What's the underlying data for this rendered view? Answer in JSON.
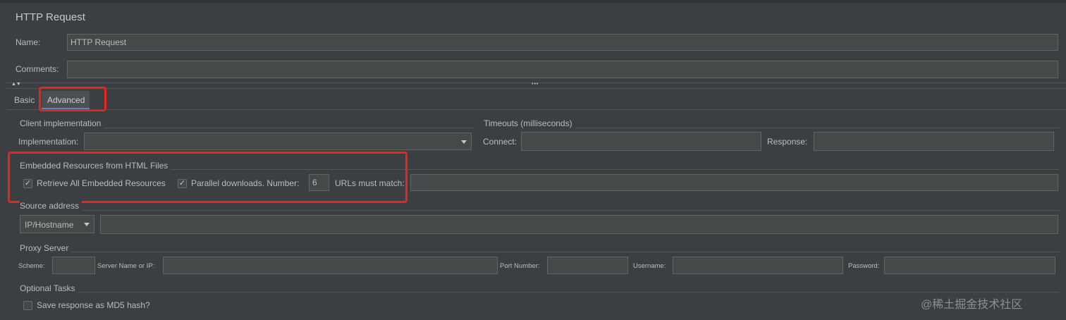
{
  "title": "HTTP Request",
  "name_label": "Name:",
  "name_value": "HTTP Request",
  "comments_label": "Comments:",
  "comments_value": "",
  "tabs": [
    {
      "label": "Basic"
    },
    {
      "label": "Advanced"
    }
  ],
  "client": {
    "title": "Client implementation",
    "impl_label": "Implementation:",
    "impl_value": ""
  },
  "timeouts": {
    "title": "Timeouts (milliseconds)",
    "connect_label": "Connect:",
    "response_label": "Response:"
  },
  "embedded": {
    "title": "Embedded Resources from HTML Files",
    "retrieve_label": "Retrieve All Embedded Resources",
    "parallel_label": "Parallel downloads. Number:",
    "parallel_number": "6",
    "urls_label": "URLs must match:"
  },
  "source": {
    "title": "Source address",
    "type_value": "IP/Hostname"
  },
  "proxy": {
    "title": "Proxy Server",
    "scheme_label": "Scheme:",
    "server_label": "Server Name or IP:",
    "port_label": "Port Number:",
    "username_label": "Username:",
    "password_label": "Password:"
  },
  "optional": {
    "title": "Optional Tasks",
    "md5_label": "Save response as MD5 hash?"
  },
  "watermark": "@稀土掘金技术社区",
  "check_mark": "✓",
  "splitter_dots": "•••",
  "splitter_arrows": "▲▼",
  "accent_color": "#e8261f"
}
